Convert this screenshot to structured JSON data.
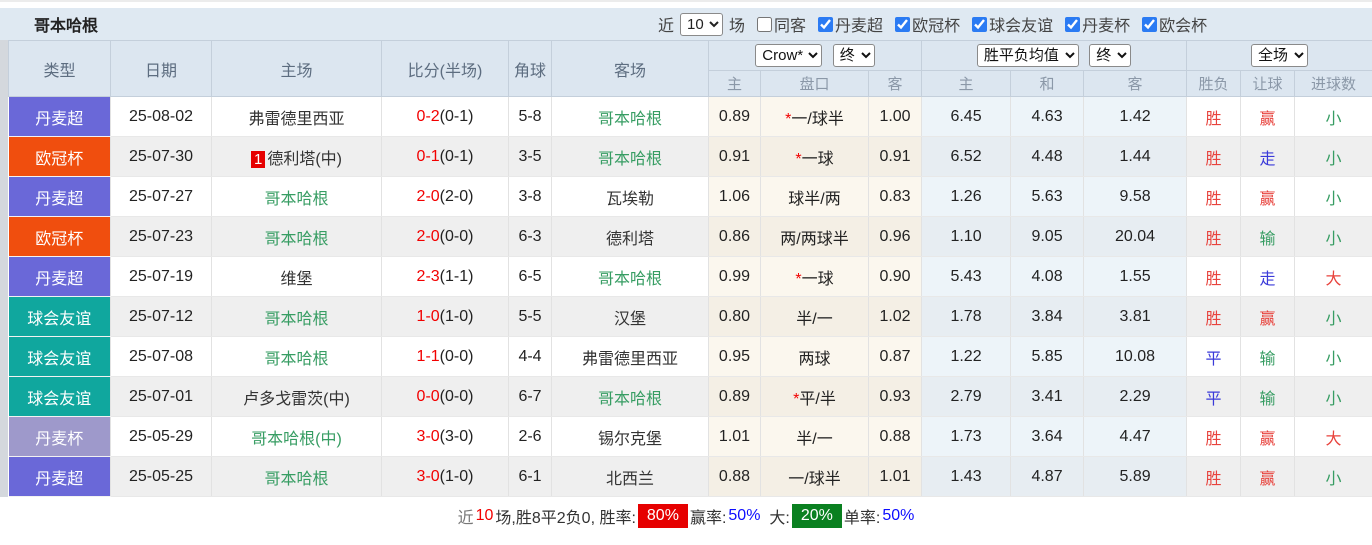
{
  "topbar": {
    "title": "哥本哈根",
    "near_label": "近",
    "count_value": "10",
    "matches_label": "场",
    "same_opponent_label": "同客",
    "leagues": [
      "丹麦超",
      "欧冠杯",
      "球会友谊",
      "丹麦杯",
      "欧会杯"
    ]
  },
  "table": {
    "headers": {
      "type": "类型",
      "date": "日期",
      "home": "主场",
      "score": "比分(半场)",
      "corner": "角球",
      "away": "客场"
    },
    "dropdowns": {
      "company": "Crow*",
      "final1": "终",
      "avg": "胜平负均值",
      "final2": "终",
      "scope": "全场"
    },
    "sub_headers": [
      "主",
      "盘口",
      "客",
      "主",
      "和",
      "客",
      "胜负",
      "让球",
      "进球数"
    ],
    "league_colors": {
      "丹麦超": "#6a68d8",
      "欧冠杯": "#f04e0e",
      "球会友谊": "#10a79e",
      "丹麦杯": "#9e99cb"
    },
    "rows": [
      {
        "league": "丹麦超",
        "date": "25-08-02",
        "home": {
          "name": "弗雷德里西亚",
          "green": false
        },
        "score": "0-2",
        "half": "(0-1)",
        "corner": "5-8",
        "away": {
          "name": "哥本哈根",
          "green": true
        },
        "odds": [
          "0.89",
          "*一/球半",
          "1.00"
        ],
        "avg": [
          "6.45",
          "4.63",
          "1.42"
        ],
        "result": {
          "text": "胜",
          "c": "red"
        },
        "handicap": {
          "text": "赢",
          "c": "red"
        },
        "goals": {
          "text": "小",
          "c": "green"
        }
      },
      {
        "league": "欧冠杯",
        "date": "25-07-30",
        "home": {
          "name": "德利塔(中)",
          "green": false,
          "badge": "1"
        },
        "score": "0-1",
        "half": "(0-1)",
        "corner": "3-5",
        "away": {
          "name": "哥本哈根",
          "green": true
        },
        "odds": [
          "0.91",
          "*一球",
          "0.91"
        ],
        "avg": [
          "6.52",
          "4.48",
          "1.44"
        ],
        "result": {
          "text": "胜",
          "c": "red"
        },
        "handicap": {
          "text": "走",
          "c": "blue"
        },
        "goals": {
          "text": "小",
          "c": "green"
        }
      },
      {
        "league": "丹麦超",
        "date": "25-07-27",
        "home": {
          "name": "哥本哈根",
          "green": true
        },
        "score": "2-0",
        "half": "(2-0)",
        "corner": "3-8",
        "away": {
          "name": "瓦埃勒",
          "green": false
        },
        "odds": [
          "1.06",
          "球半/两",
          "0.83"
        ],
        "avg": [
          "1.26",
          "5.63",
          "9.58"
        ],
        "result": {
          "text": "胜",
          "c": "red"
        },
        "handicap": {
          "text": "赢",
          "c": "red"
        },
        "goals": {
          "text": "小",
          "c": "green"
        }
      },
      {
        "league": "欧冠杯",
        "date": "25-07-23",
        "home": {
          "name": "哥本哈根",
          "green": true
        },
        "score": "2-0",
        "half": "(0-0)",
        "corner": "6-3",
        "away": {
          "name": "德利塔",
          "green": false
        },
        "odds": [
          "0.86",
          "两/两球半",
          "0.96"
        ],
        "avg": [
          "1.10",
          "9.05",
          "20.04"
        ],
        "result": {
          "text": "胜",
          "c": "red"
        },
        "handicap": {
          "text": "输",
          "c": "green"
        },
        "goals": {
          "text": "小",
          "c": "green"
        }
      },
      {
        "league": "丹麦超",
        "date": "25-07-19",
        "home": {
          "name": "维堡",
          "green": false
        },
        "score": "2-3",
        "half": "(1-1)",
        "corner": "6-5",
        "away": {
          "name": "哥本哈根",
          "green": true
        },
        "odds": [
          "0.99",
          "*一球",
          "0.90"
        ],
        "avg": [
          "5.43",
          "4.08",
          "1.55"
        ],
        "result": {
          "text": "胜",
          "c": "red"
        },
        "handicap": {
          "text": "走",
          "c": "blue"
        },
        "goals": {
          "text": "大",
          "c": "red"
        }
      },
      {
        "league": "球会友谊",
        "date": "25-07-12",
        "home": {
          "name": "哥本哈根",
          "green": true
        },
        "score": "1-0",
        "half": "(1-0)",
        "corner": "5-5",
        "away": {
          "name": "汉堡",
          "green": false
        },
        "odds": [
          "0.80",
          "半/一",
          "1.02"
        ],
        "avg": [
          "1.78",
          "3.84",
          "3.81"
        ],
        "result": {
          "text": "胜",
          "c": "red"
        },
        "handicap": {
          "text": "赢",
          "c": "red"
        },
        "goals": {
          "text": "小",
          "c": "green"
        }
      },
      {
        "league": "球会友谊",
        "date": "25-07-08",
        "home": {
          "name": "哥本哈根",
          "green": true
        },
        "score": "1-1",
        "half": "(0-0)",
        "corner": "4-4",
        "away": {
          "name": "弗雷德里西亚",
          "green": false
        },
        "odds": [
          "0.95",
          "两球",
          "0.87"
        ],
        "avg": [
          "1.22",
          "5.85",
          "10.08"
        ],
        "result": {
          "text": "平",
          "c": "blue"
        },
        "handicap": {
          "text": "输",
          "c": "green"
        },
        "goals": {
          "text": "小",
          "c": "green"
        }
      },
      {
        "league": "球会友谊",
        "date": "25-07-01",
        "home": {
          "name": "卢多戈雷茨(中)",
          "green": false
        },
        "score": "0-0",
        "half": "(0-0)",
        "corner": "6-7",
        "away": {
          "name": "哥本哈根",
          "green": true
        },
        "odds": [
          "0.89",
          "*平/半",
          "0.93"
        ],
        "avg": [
          "2.79",
          "3.41",
          "2.29"
        ],
        "result": {
          "text": "平",
          "c": "blue"
        },
        "handicap": {
          "text": "输",
          "c": "green"
        },
        "goals": {
          "text": "小",
          "c": "green"
        }
      },
      {
        "league": "丹麦杯",
        "date": "25-05-29",
        "home": {
          "name": "哥本哈根(中)",
          "green": true
        },
        "score": "3-0",
        "half": "(3-0)",
        "corner": "2-6",
        "away": {
          "name": "锡尔克堡",
          "green": false
        },
        "odds": [
          "1.01",
          "半/一",
          "0.88"
        ],
        "avg": [
          "1.73",
          "3.64",
          "4.47"
        ],
        "result": {
          "text": "胜",
          "c": "red"
        },
        "handicap": {
          "text": "赢",
          "c": "red"
        },
        "goals": {
          "text": "大",
          "c": "red"
        }
      },
      {
        "league": "丹麦超",
        "date": "25-05-25",
        "home": {
          "name": "哥本哈根",
          "green": true
        },
        "score": "3-0",
        "half": "(1-0)",
        "corner": "6-1",
        "away": {
          "name": "北西兰",
          "green": false
        },
        "odds": [
          "0.88",
          "一/球半",
          "1.01"
        ],
        "avg": [
          "1.43",
          "4.87",
          "5.89"
        ],
        "result": {
          "text": "胜",
          "c": "red"
        },
        "handicap": {
          "text": "赢",
          "c": "red"
        },
        "goals": {
          "text": "小",
          "c": "green"
        }
      }
    ]
  },
  "summary": {
    "near_label": "近",
    "count": "10",
    "record_text": "场,胜8平2负0, 胜率:",
    "win_rate": "80%",
    "handicap_label": "赢率:",
    "handicap_rate": "50%",
    "big_label": "大:",
    "big_rate": "20%",
    "single_label": "单率:",
    "single_rate": "50%"
  }
}
